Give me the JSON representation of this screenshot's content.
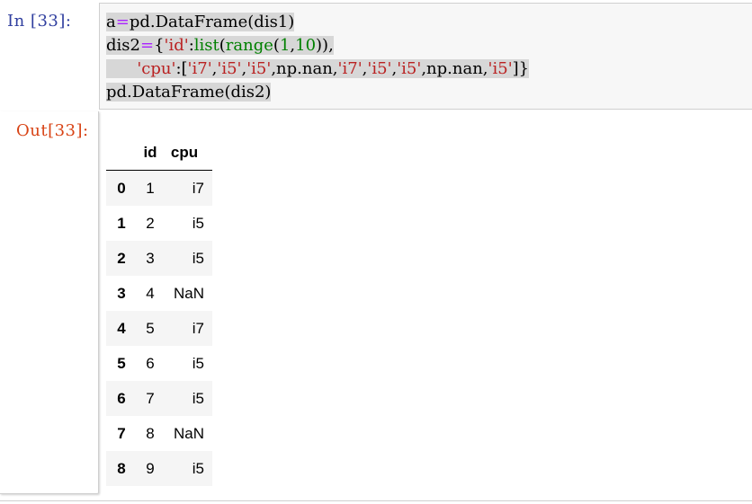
{
  "cell": {
    "in_prompt": "In  [33]:",
    "out_prompt": "Out[33]:",
    "code_lines": [
      [
        {
          "t": "a",
          "c": "p"
        },
        {
          "t": "=",
          "c": "op"
        },
        {
          "t": "pd.DataFrame(dis1)",
          "c": "p"
        }
      ],
      [
        {
          "t": "dis2",
          "c": "p"
        },
        {
          "t": "=",
          "c": "op"
        },
        {
          "t": "{",
          "c": "p"
        },
        {
          "t": "'id'",
          "c": "str"
        },
        {
          "t": ":",
          "c": "p"
        },
        {
          "t": "list",
          "c": "bi"
        },
        {
          "t": "(",
          "c": "p"
        },
        {
          "t": "range",
          "c": "bi"
        },
        {
          "t": "(",
          "c": "p"
        },
        {
          "t": "1",
          "c": "num"
        },
        {
          "t": ",",
          "c": "p"
        },
        {
          "t": "10",
          "c": "num"
        },
        {
          "t": ")),",
          "c": "p"
        }
      ],
      [
        {
          "t": "      ",
          "c": "p"
        },
        {
          "t": "'cpu'",
          "c": "str"
        },
        {
          "t": ":[",
          "c": "p"
        },
        {
          "t": "'i7'",
          "c": "str"
        },
        {
          "t": ",",
          "c": "p"
        },
        {
          "t": "'i5'",
          "c": "str"
        },
        {
          "t": ",",
          "c": "p"
        },
        {
          "t": "'i5'",
          "c": "str"
        },
        {
          "t": ",np.nan,",
          "c": "p"
        },
        {
          "t": "'i7'",
          "c": "str"
        },
        {
          "t": ",",
          "c": "p"
        },
        {
          "t": "'i5'",
          "c": "str"
        },
        {
          "t": ",",
          "c": "p"
        },
        {
          "t": "'i5'",
          "c": "str"
        },
        {
          "t": ",np.nan,",
          "c": "p"
        },
        {
          "t": "'i5'",
          "c": "str"
        },
        {
          "t": "]}",
          "c": "p"
        }
      ],
      [
        {
          "t": "pd.DataFrame(dis2)",
          "c": "p"
        }
      ]
    ]
  },
  "dataframe": {
    "columns": [
      "id",
      "cpu"
    ],
    "rows": [
      {
        "index": "0",
        "id": "1",
        "cpu": "i7"
      },
      {
        "index": "1",
        "id": "2",
        "cpu": "i5"
      },
      {
        "index": "2",
        "id": "3",
        "cpu": "i5"
      },
      {
        "index": "3",
        "id": "4",
        "cpu": "NaN"
      },
      {
        "index": "4",
        "id": "5",
        "cpu": "i7"
      },
      {
        "index": "5",
        "id": "6",
        "cpu": "i5"
      },
      {
        "index": "6",
        "id": "7",
        "cpu": "i5"
      },
      {
        "index": "7",
        "id": "8",
        "cpu": "NaN"
      },
      {
        "index": "8",
        "id": "9",
        "cpu": "i5"
      }
    ]
  },
  "colors": {
    "in_prompt": "#303f9f",
    "out_prompt": "#d84315",
    "string": "#ba2121",
    "builtin": "#008000",
    "operator": "#aa22ff",
    "input_bg": "#f7f7f7",
    "selection": "#d7d7d7"
  }
}
